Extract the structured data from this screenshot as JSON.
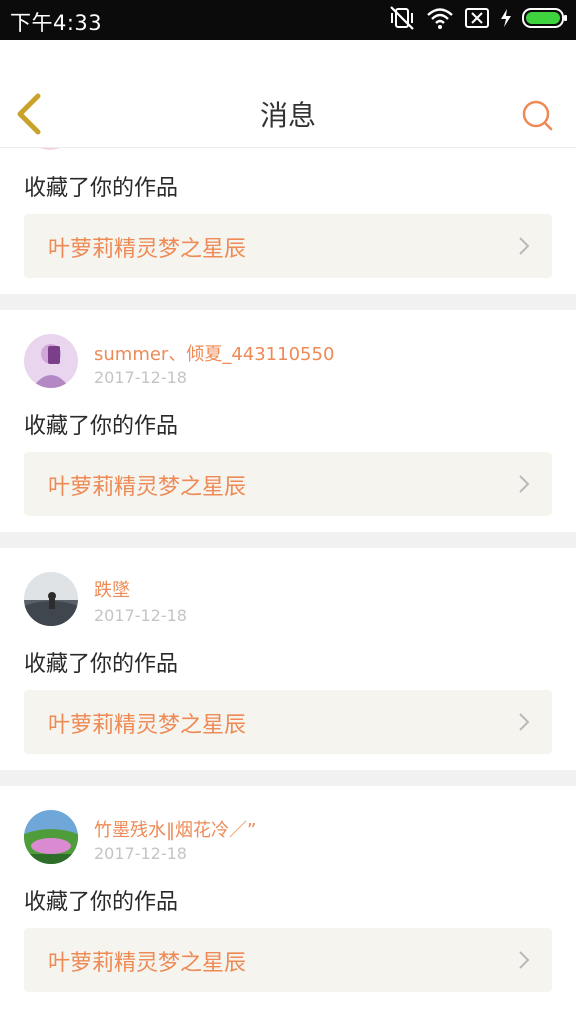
{
  "status_bar": {
    "time": "下午4:33"
  },
  "header": {
    "title": "消息"
  },
  "feed": {
    "items": [
      {
        "user": "",
        "date": "",
        "action": "收藏了你的作品",
        "work_title": "叶萝莉精灵梦之星辰"
      },
      {
        "user": "summer、倾夏_443110550",
        "date": "2017-12-18",
        "action": "收藏了你的作品",
        "work_title": "叶萝莉精灵梦之星辰"
      },
      {
        "user": "跌墜",
        "date": "2017-12-18",
        "action": "收藏了你的作品",
        "work_title": "叶萝莉精灵梦之星辰"
      },
      {
        "user": "竹墨残水‖烟花冷／”",
        "date": "2017-12-18",
        "action": "收藏了你的作品",
        "work_title": "叶萝莉精灵梦之星辰"
      }
    ]
  },
  "colors": {
    "accent": "#ee8a55",
    "link_bg": "#f5f4ef",
    "back_arrow": "#c9a22a",
    "battery": "#3fd23f"
  },
  "icons": {
    "back": "chevron-left-icon",
    "search": "search-icon",
    "chevron": "chevron-right-icon",
    "mute": "vibrate-off-icon",
    "wifi": "wifi-icon",
    "sim": "no-sim-icon",
    "charging": "charging-icon",
    "battery": "battery-icon"
  }
}
